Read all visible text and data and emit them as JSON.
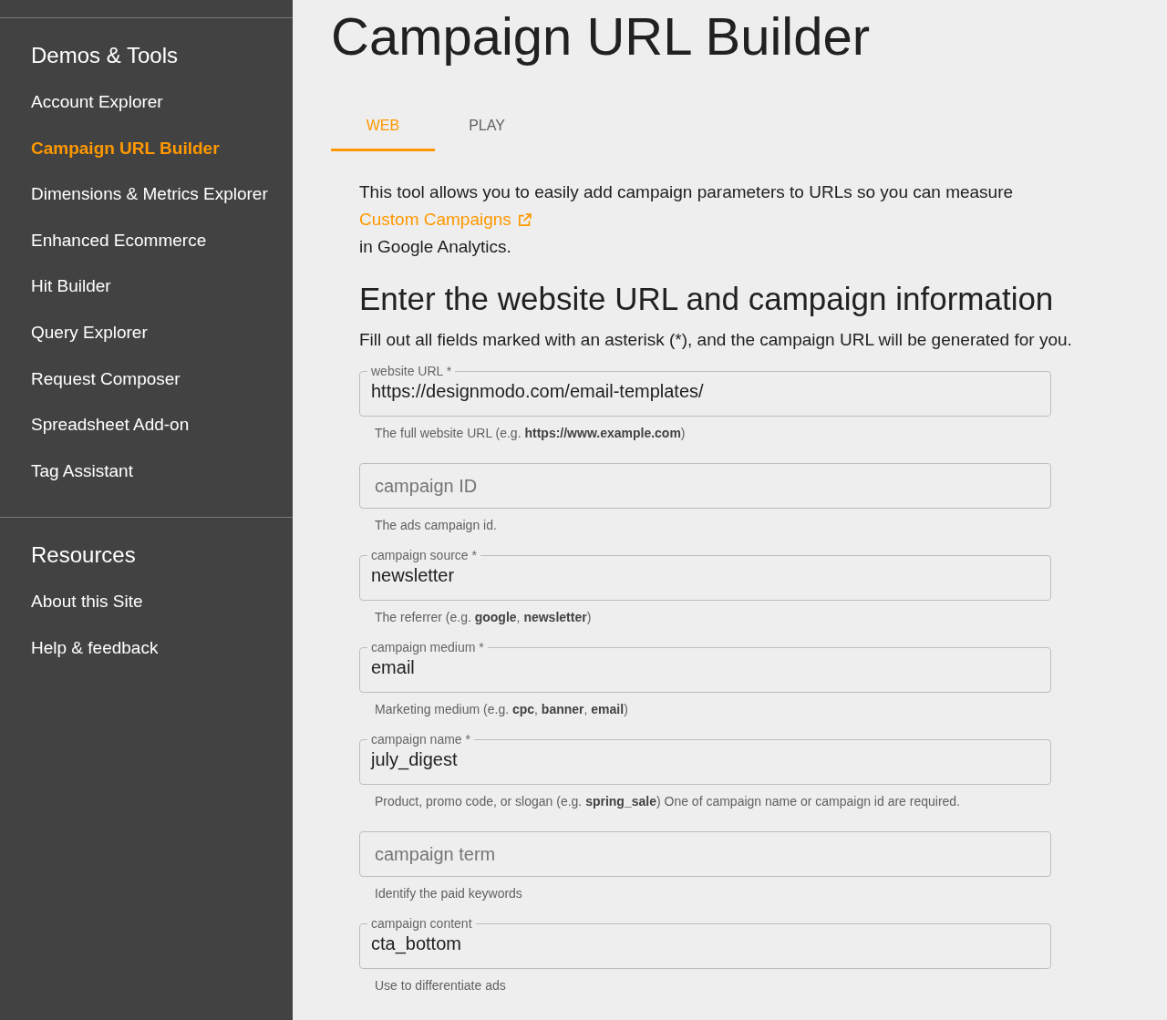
{
  "sidebar": {
    "sections": [
      {
        "title": "Demos & Tools",
        "items": [
          {
            "label": "Account Explorer",
            "selected": false
          },
          {
            "label": "Campaign URL Builder",
            "selected": true
          },
          {
            "label": "Dimensions & Metrics Explorer",
            "selected": false
          },
          {
            "label": "Enhanced Ecommerce",
            "selected": false
          },
          {
            "label": "Hit Builder",
            "selected": false
          },
          {
            "label": "Query Explorer",
            "selected": false
          },
          {
            "label": "Request Composer",
            "selected": false
          },
          {
            "label": "Spreadsheet Add-on",
            "selected": false
          },
          {
            "label": "Tag Assistant",
            "selected": false
          }
        ]
      },
      {
        "title": "Resources",
        "items": [
          {
            "label": "About this Site",
            "selected": false
          },
          {
            "label": "Help & feedback",
            "selected": false
          }
        ]
      }
    ]
  },
  "page": {
    "title": "Campaign URL Builder",
    "tabs": [
      {
        "label": "WEB",
        "selected": true
      },
      {
        "label": "PLAY",
        "selected": false
      }
    ],
    "intro": {
      "text": "This tool allows you to easily add campaign parameters to URLs so you can measure",
      "link": "Custom Campaigns",
      "after": "in Google Analytics."
    },
    "heading": "Enter the website URL and campaign information",
    "instruction": "Fill out all fields marked with an asterisk (*), and the campaign URL will be generated for you.",
    "fields": [
      {
        "label": "website URL *",
        "value": "https://designmodo.com/email-templates/",
        "help": "The full website URL (e.g. **https://www.example.com**)"
      },
      {
        "placeholder": "campaign ID",
        "help": "The ads campaign id."
      },
      {
        "label": "campaign source *",
        "value": "newsletter",
        "help": "The referrer (e.g. **google**, **newsletter**)"
      },
      {
        "label": "campaign medium *",
        "value": "email",
        "help": "Marketing medium (e.g. **cpc**, **banner**, **email**)"
      },
      {
        "label": "campaign name *",
        "value": "july_digest",
        "help": "Product, promo code, or slogan (e.g. **spring_sale**) One of campaign name or campaign id are required."
      },
      {
        "placeholder": "campaign term",
        "help": "Identify the paid keywords"
      },
      {
        "label": "campaign content",
        "value": "cta_bottom",
        "help": "Use to differentiate ads"
      }
    ]
  }
}
